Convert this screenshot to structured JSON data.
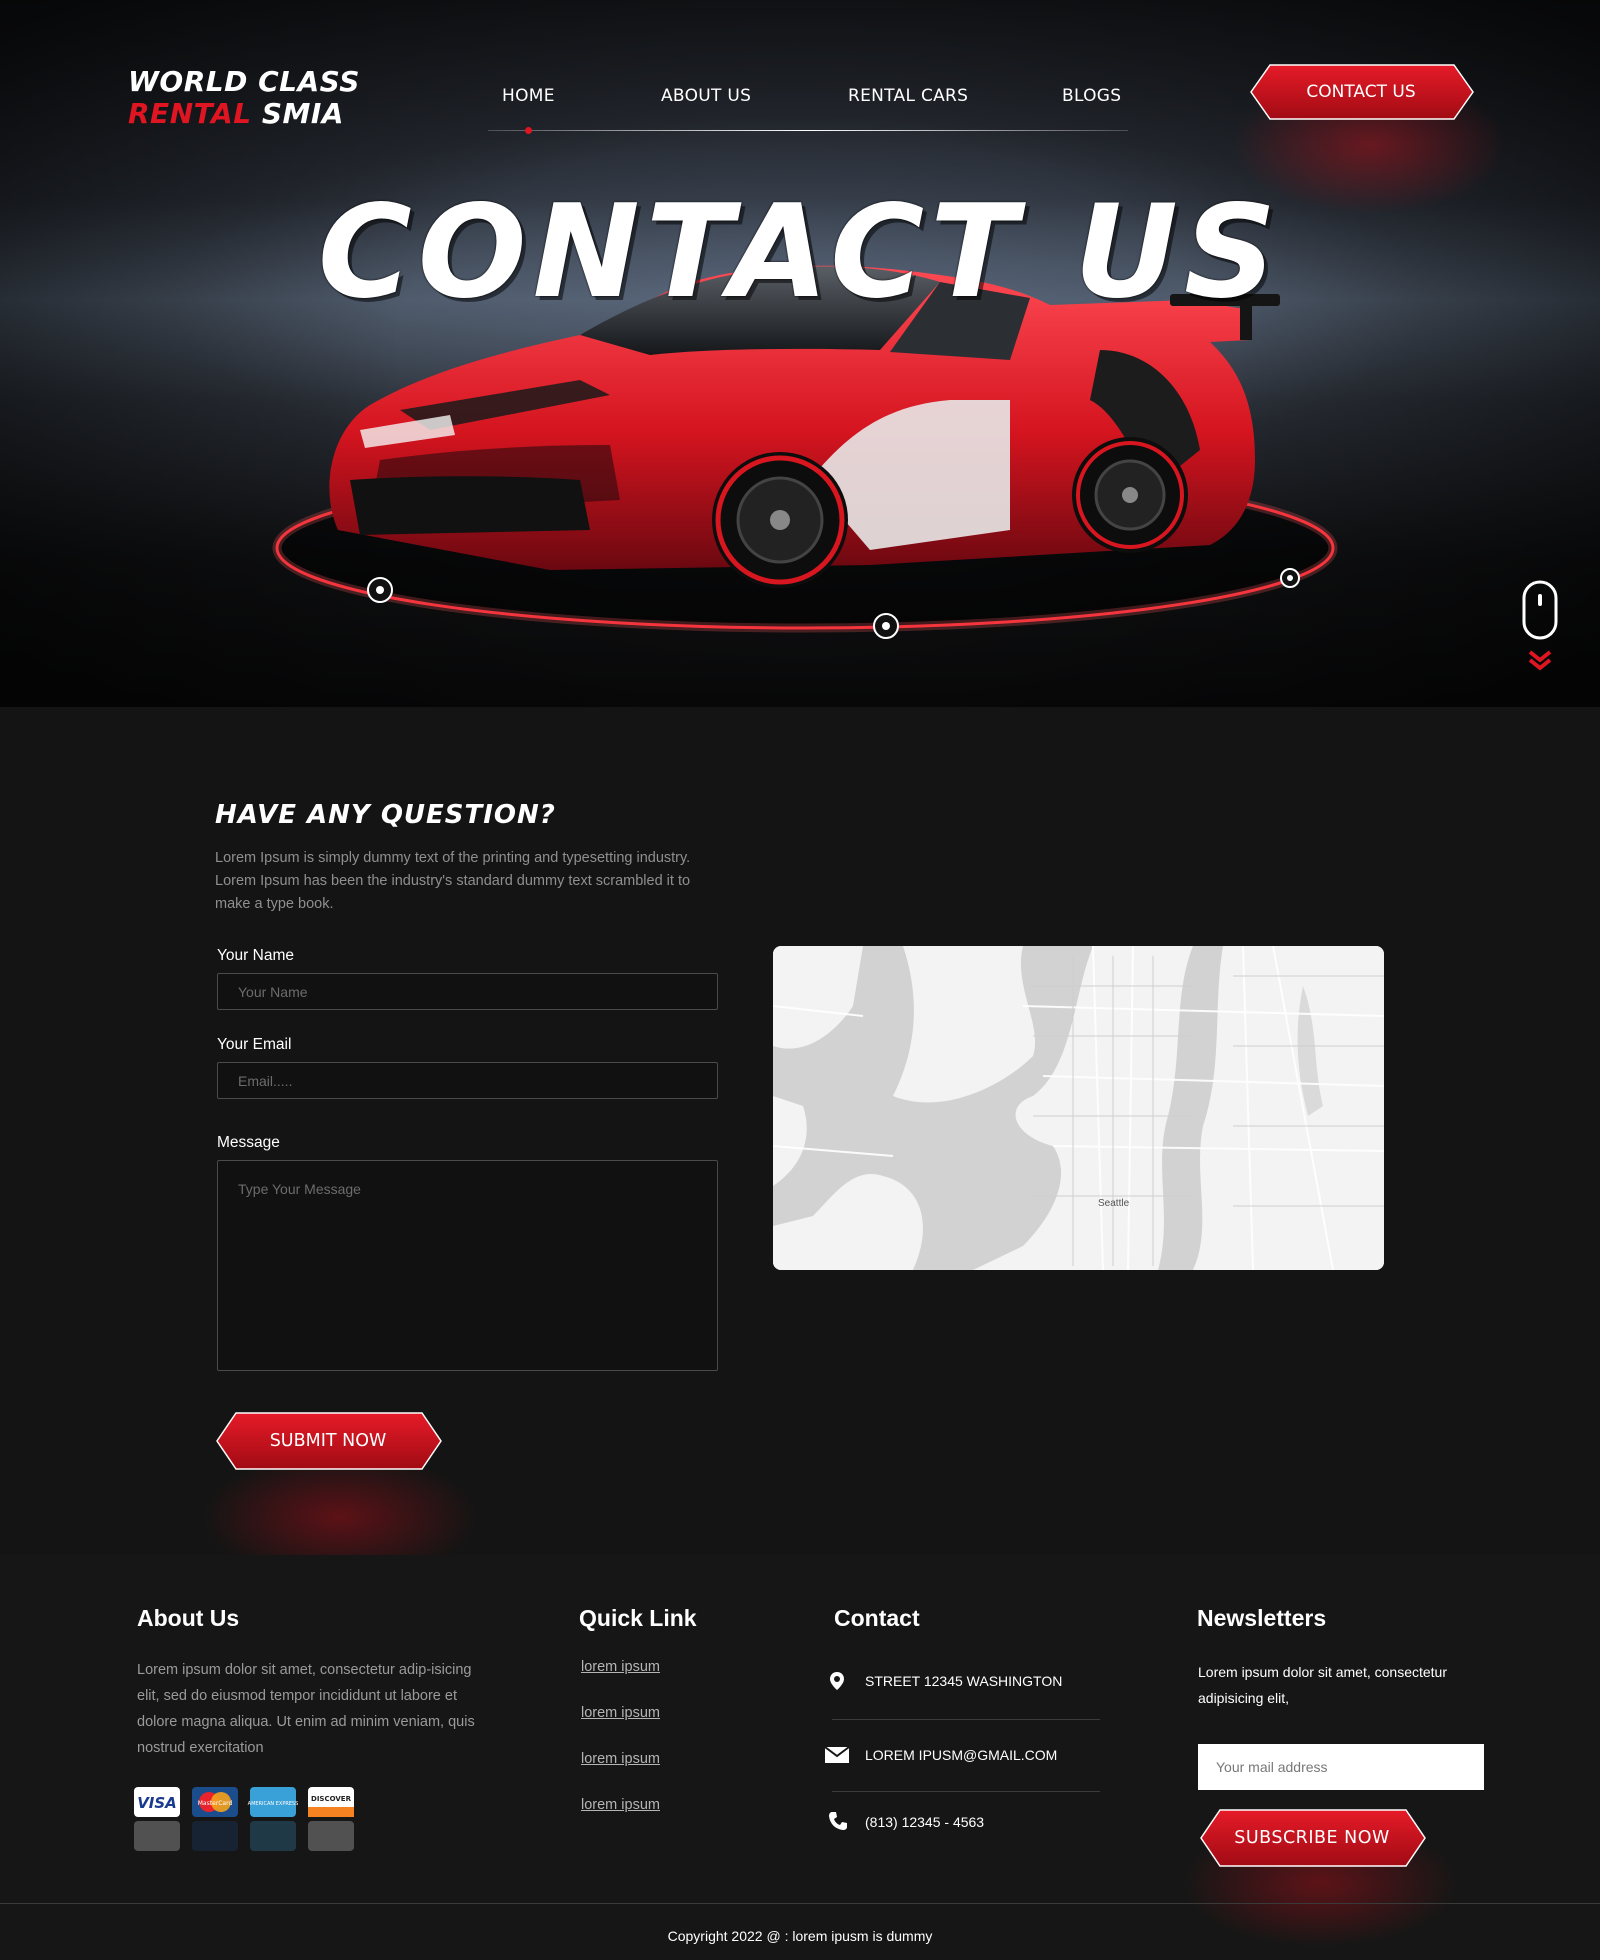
{
  "brand": {
    "line1": "WORLD CLASS",
    "line2_red": "RENTAL",
    "line2_white": "SMIA"
  },
  "nav": {
    "home": "HOME",
    "about": "ABOUT US",
    "rental": "RENTAL CARS",
    "blogs": "BLOGS",
    "active": "HOME"
  },
  "header": {
    "contact_button": "CONTACT US"
  },
  "hero": {
    "title": "CONTACT US"
  },
  "form": {
    "title": "HAVE ANY QUESTION?",
    "description": "Lorem Ipsum is simply dummy text of the printing and typesetting industry. Lorem Ipsum has been the industry's standard dummy text scrambled it to make a type book.",
    "name_label": "Your Name",
    "name_placeholder": "Your Name",
    "email_label": "Your Email",
    "email_placeholder": "Email.....",
    "message_label": "Message",
    "message_placeholder": "Type Your Message",
    "submit": "SUBMIT NOW"
  },
  "map": {
    "city": "Seattle"
  },
  "footer": {
    "about": {
      "title": "About Us",
      "text": "Lorem ipsum dolor sit amet, consectetur adip-isicing elit, sed do eiusmod tempor incididunt ut labore et dolore magna aliqua. Ut enim ad minim veniam, quis nostrud exercitation",
      "cards": [
        "VISA",
        "MasterCard",
        "AMERICAN EXPRESS",
        "DISCOVER"
      ]
    },
    "quick": {
      "title": "Quick Link",
      "links": [
        "lorem ipsum",
        "lorem ipsum",
        "lorem ipsum",
        "lorem ipsum"
      ]
    },
    "contact": {
      "title": "Contact",
      "address": "STREET 12345 WASHINGTON",
      "email": "LOREM IPUSM@GMAIL.COM",
      "phone": "(813) 12345 - 4563"
    },
    "news": {
      "title": "Newsletters",
      "text": "Lorem ipsum dolor sit amet, consectetur adipisicing elit,",
      "placeholder": "Your mail address",
      "button": "SUBSCRIBE NOW"
    },
    "copyright": "Copyright 2022  @ : lorem ipusm is dummy"
  },
  "colors": {
    "accent": "#e01522",
    "accent_dark": "#a10b14",
    "background": "#141414"
  },
  "icons": [
    "mouse-scroll-icon",
    "chevron-down-icon",
    "location-pin-icon",
    "envelope-icon",
    "phone-icon"
  ]
}
